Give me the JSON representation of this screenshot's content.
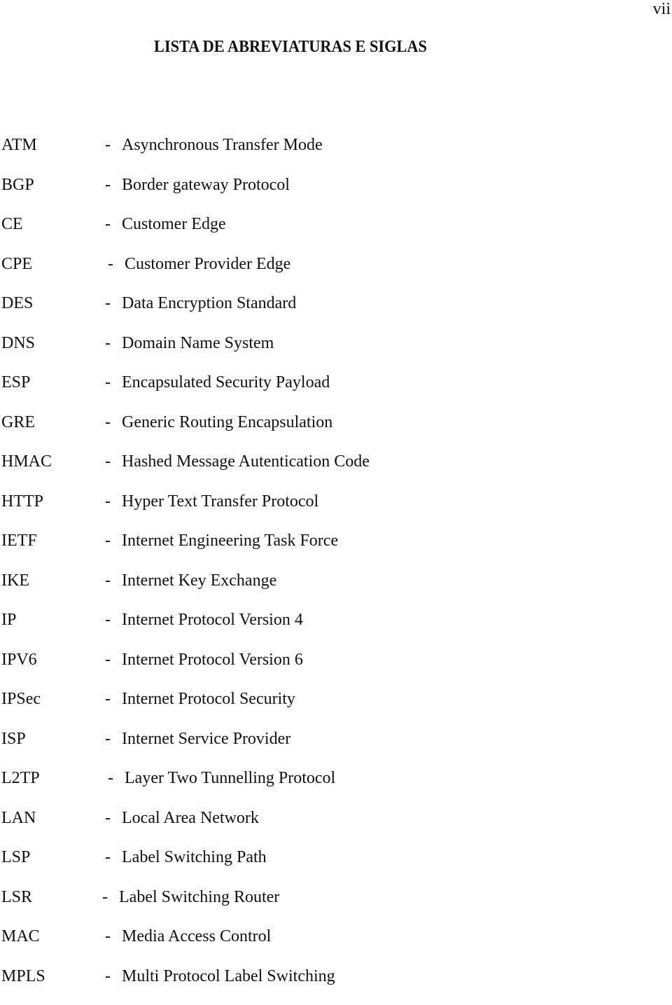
{
  "page_number": "vii",
  "title": "LISTA DE ABREVIATURAS E SIGLAS",
  "separator": "-",
  "entries": [
    {
      "abbr": "ATM",
      "definition": "Asynchronous Transfer Mode"
    },
    {
      "abbr": "BGP",
      "definition": "Border gateway Protocol"
    },
    {
      "abbr": "CE",
      "definition": "Customer Edge"
    },
    {
      "abbr": "CPE",
      "definition": "Customer Provider Edge"
    },
    {
      "abbr": "DES",
      "definition": "Data Encryption Standard"
    },
    {
      "abbr": "DNS",
      "definition": "Domain Name System"
    },
    {
      "abbr": "ESP",
      "definition": "Encapsulated Security Payload"
    },
    {
      "abbr": "GRE",
      "definition": "Generic Routing Encapsulation"
    },
    {
      "abbr": "HMAC",
      "definition": "Hashed Message Autentication Code"
    },
    {
      "abbr": "HTTP",
      "definition": "Hyper Text Transfer Protocol"
    },
    {
      "abbr": "IETF",
      "definition": "Internet Engineering Task Force"
    },
    {
      "abbr": "IKE",
      "definition": "Internet Key Exchange"
    },
    {
      "abbr": "IP",
      "definition": "Internet Protocol Version 4"
    },
    {
      "abbr": "IPV6",
      "definition": "Internet Protocol Version 6"
    },
    {
      "abbr": "IPSec",
      "definition": "Internet Protocol Security"
    },
    {
      "abbr": "ISP",
      "definition": "Internet Service Provider"
    },
    {
      "abbr": "L2TP",
      "definition": "Layer Two Tunnelling Protocol"
    },
    {
      "abbr": "LAN",
      "definition": "Local Area Network"
    },
    {
      "abbr": "LSP",
      "definition": "Label Switching Path"
    },
    {
      "abbr": "LSR",
      "definition": "Label Switching Router"
    },
    {
      "abbr": "MAC",
      "definition": "Media Access Control"
    },
    {
      "abbr": "MPLS",
      "definition": "Multi Protocol Label Switching"
    }
  ]
}
